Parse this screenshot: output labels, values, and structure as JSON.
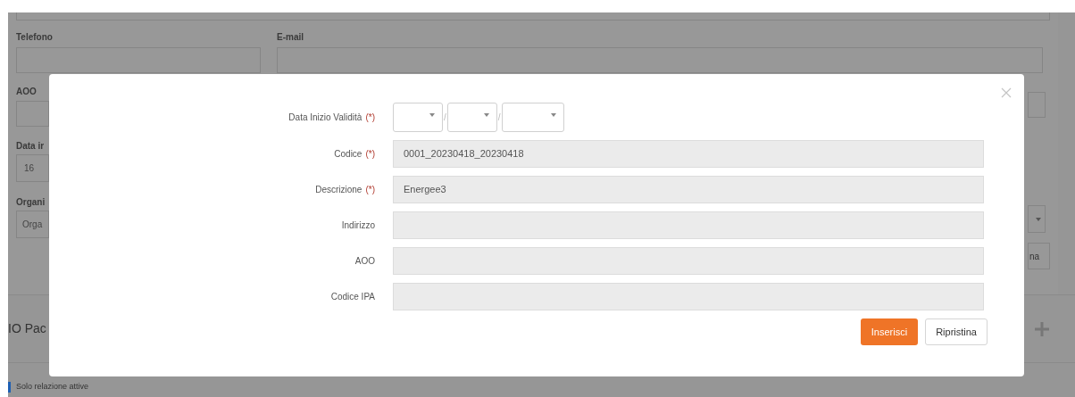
{
  "background": {
    "labels": {
      "telefono": "Telefono",
      "email": "E-mail",
      "aoo": "AOO",
      "data": "Data ir",
      "organizzazione": "Organi"
    },
    "data_value": "16",
    "organizzazione_value": "Orga",
    "right_button": "na",
    "section_title": "IO Pac",
    "filter": {
      "label": "Solo relazione attive",
      "checked": true
    }
  },
  "modal": {
    "fields": [
      {
        "kind": "date",
        "label": "Data Inizio Validità",
        "required_mark": "(*)",
        "separators": [
          "/",
          "/"
        ]
      },
      {
        "kind": "text",
        "label": "Codice",
        "required_mark": "(*)",
        "value": "0001_20230418_20230418"
      },
      {
        "kind": "text",
        "label": "Descrizione",
        "required_mark": "(*)",
        "value": "Energee3"
      },
      {
        "kind": "text",
        "label": "Indirizzo"
      },
      {
        "kind": "text",
        "label": "AOO"
      },
      {
        "kind": "text",
        "label": "Codice IPA"
      }
    ],
    "buttons": [
      {
        "kind": "primary",
        "label": "Inserisci"
      },
      {
        "kind": "secondary",
        "label": "Ripristina"
      }
    ]
  }
}
